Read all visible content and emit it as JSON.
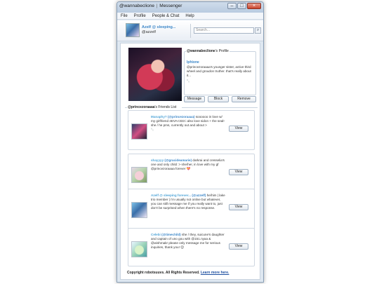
{
  "window": {
    "title": "@wannabeclione",
    "app_name": "Messenger",
    "controls": [
      "–",
      "□",
      "×"
    ]
  },
  "menu": [
    "File",
    "Profile",
    "People & Chat",
    "Help"
  ],
  "header": {
    "display_name": "Azelf @ sleeping...",
    "handle": "@azzelf",
    "search_placeholder": "Search...",
    "search_icon": "search-icon"
  },
  "profile": {
    "legend_handle": "@wannabeclione",
    "legend_suffix": "'s Profile",
    "name": "Iphione",
    "bio": "@princezoraaaa's younger sister, active third wheel and groudon truther. that's really about it...",
    "bio_icon": "⁰₀",
    "buttons": {
      "message": "Message",
      "block": "Block",
      "remove": "Remove"
    }
  },
  "friends": {
    "legend_handle": "@princezoraaaa",
    "legend_suffix": "'s Friends List",
    "view_label": "View",
    "items": [
      {
        "name": "Manaphy?",
        "handle": "(@princezoraaaa)",
        "text": "soooooo in love w/ my girlfriend 4EVA<333 i also love sidon + the seal! she / he pms, currently out and about >",
        "icon": "⁰₀"
      },
      {
        "name": "shayyyy",
        "handle": "(@gracideamarie)",
        "text": "darkrai and cresselia's one and only child :> she/her, in love with my gf @princezoraaaa forever 💝",
        "icon": ""
      },
      {
        "name": "Azelf @ sleeping forever...",
        "handle": "(@azzelf)",
        "text": "he/him | lake trio member | i'm usually not online but whatever, you can still message me if you really want to, just don't be surprised when there's no response.",
        "icon": ""
      },
      {
        "name": "Celebi",
        "handle": "(@timechild)",
        "text": "she / they, suicune's daughter and captain of uno gou with @151.nyaa & @wishmakr please only message me for serious inquiries, thank you! 😊",
        "icon": ""
      }
    ]
  },
  "footer": {
    "copyright": "Copyright robotsuuvs. All Rights Reserved.",
    "link": "Learn more here."
  }
}
